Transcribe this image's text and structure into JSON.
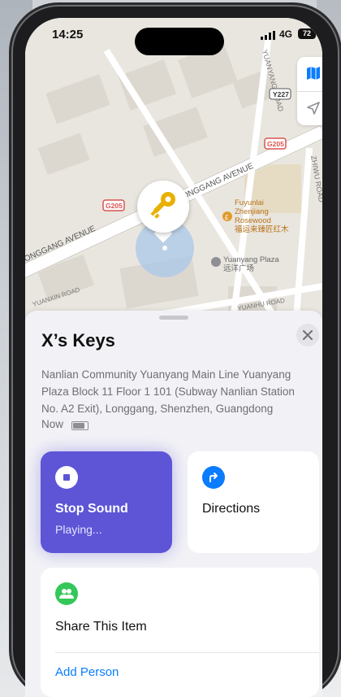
{
  "status_bar": {
    "time": "14:25",
    "network": "4G",
    "battery": "72"
  },
  "map": {
    "labels": {
      "longgang_avenue_top": "LONGGANG AVENUE",
      "longgang_avenue_left": "LONGGANG AVENUE",
      "yuanyang_road_top": "YUANYANG ROAD",
      "yuanxin_road": "YUANXIN ROAD",
      "yuanhu_road": "YUANHU ROAD",
      "zhiwu_road": "ZHIWU ROAD",
      "fuyunlai_line1": "Fuyunlai",
      "fuyunlai_line2": "Zhenjiang",
      "fuyunlai_line3": "Rosewood",
      "fuyunlai_cn": "福运来臻匠红木",
      "yuanyang_plaza_en": "Yuanyang Plaza",
      "yuanyang_plaza_cn": "远洋广场"
    },
    "shields": {
      "g205_a": "G205",
      "g205_b": "G205",
      "y227": "Y227"
    },
    "map_mode_icon": "map-icon",
    "locate_icon": "location-arrow-icon",
    "pin_icon": "key-icon",
    "colors": {
      "water_accuracy": "#a9c8ea",
      "road": "#ffffff",
      "block": "#dcd8d0",
      "park": "#e6dcc4"
    }
  },
  "sheet": {
    "title": "X’s Keys",
    "address": "Nanlian Community Yuanyang Main Line Yuanyang Plaza Block 11 Floor 1 101 (Subway Nanlian Station No. A2 Exit), Longgang, Shenzhen, Guangdong",
    "time_label": "Now",
    "close_icon": "close-icon"
  },
  "actions": {
    "stop_sound": {
      "label": "Stop Sound",
      "status": "Playing...",
      "color": "#5d55d6"
    },
    "directions": {
      "label": "Directions",
      "color": "#0a7cff"
    },
    "share": {
      "label": "Share This Item",
      "link": "Add Person",
      "color": "#34c759"
    }
  }
}
